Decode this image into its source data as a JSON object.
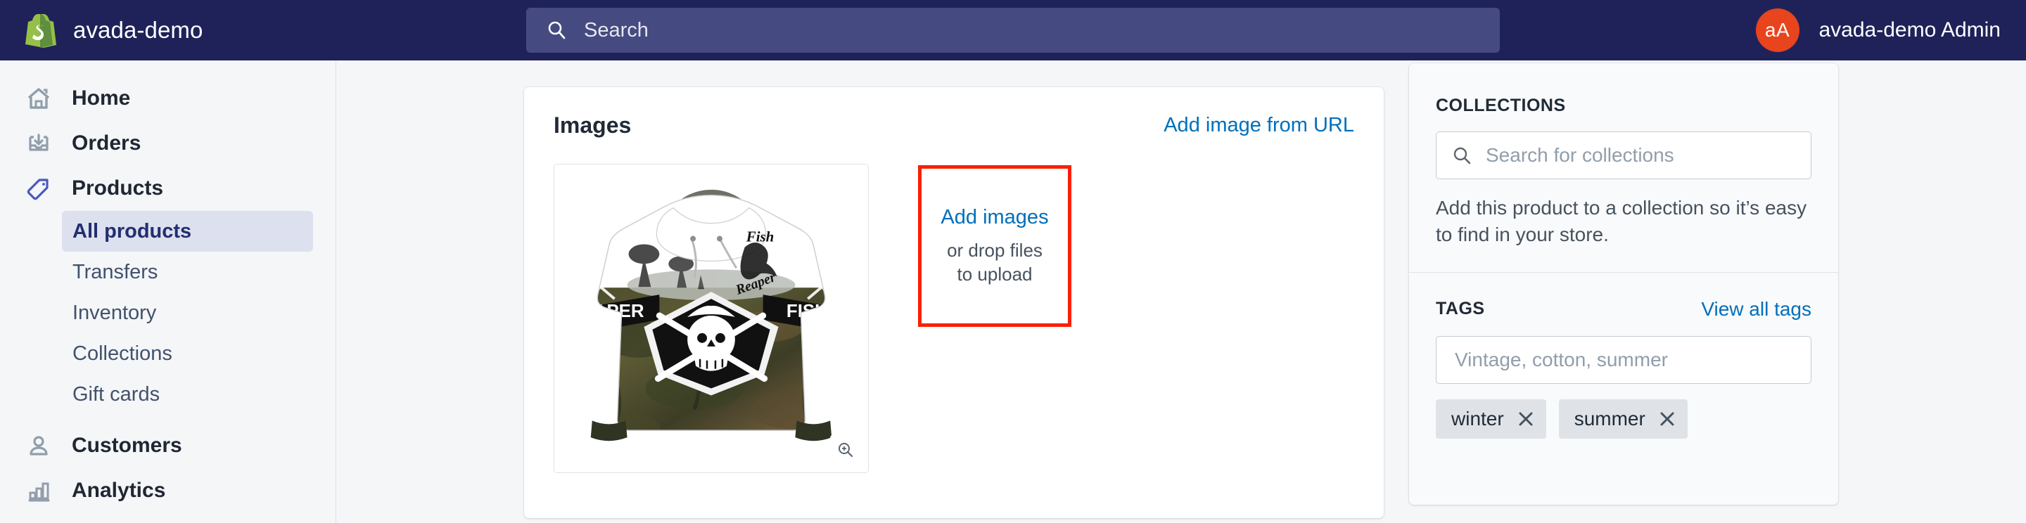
{
  "topbar": {
    "brand_name": "avada-demo",
    "logo_icon": "shopify-bag-icon",
    "search": {
      "icon": "search-icon",
      "placeholder": "Search",
      "value": ""
    },
    "user": {
      "avatar_initials": "aA",
      "name": "avada-demo Admin",
      "avatar_color": "#e8441d"
    }
  },
  "sidebar": {
    "items": [
      {
        "label": "Home",
        "icon": "home-icon",
        "active": false
      },
      {
        "label": "Orders",
        "icon": "orders-inbox-icon",
        "active": false
      },
      {
        "label": "Products",
        "icon": "products-tag-icon",
        "active": true
      }
    ],
    "product_subitems": [
      {
        "label": "All products",
        "selected": true
      },
      {
        "label": "Transfers",
        "selected": false
      },
      {
        "label": "Inventory",
        "selected": false
      },
      {
        "label": "Collections",
        "selected": false
      },
      {
        "label": "Gift cards",
        "selected": false
      }
    ],
    "items_after": [
      {
        "label": "Customers",
        "icon": "customers-person-icon",
        "active": false
      },
      {
        "label": "Analytics",
        "icon": "analytics-bars-icon",
        "active": false
      }
    ]
  },
  "images_card": {
    "title": "Images",
    "add_image_from_url": "Add image from URL",
    "thumbnail": {
      "alt": "Fish Reaper camo hoodie",
      "zoom_icon": "magnifier-plus-icon",
      "graphic_text_fish": "Fish",
      "graphic_text_reaper": "Reaper",
      "graphic_text_left_band": "REAPER",
      "graphic_text_right_band": "FISH R"
    },
    "dropzone": {
      "add_label": "Add images",
      "hint_line1": "or drop files",
      "hint_line2": "to upload",
      "highlight_color": "#fa2000"
    }
  },
  "right_panel": {
    "collections": {
      "title": "COLLECTIONS",
      "search_icon": "search-icon",
      "search_placeholder": "Search for collections",
      "search_value": "",
      "help_text": "Add this product to a collection so it’s easy to find in your store."
    },
    "tags": {
      "title": "TAGS",
      "view_all_label": "View all tags",
      "input_placeholder": "Vintage, cotton, summer",
      "input_value": "",
      "chips": [
        {
          "label": "winter",
          "remove_icon": "close-icon"
        },
        {
          "label": "summer",
          "remove_icon": "close-icon"
        }
      ]
    }
  },
  "colors": {
    "topbar_bg": "#1f2259",
    "accent_link": "#006fbb",
    "active_nav": "#222e70",
    "page_bg": "#f4f6f8"
  }
}
